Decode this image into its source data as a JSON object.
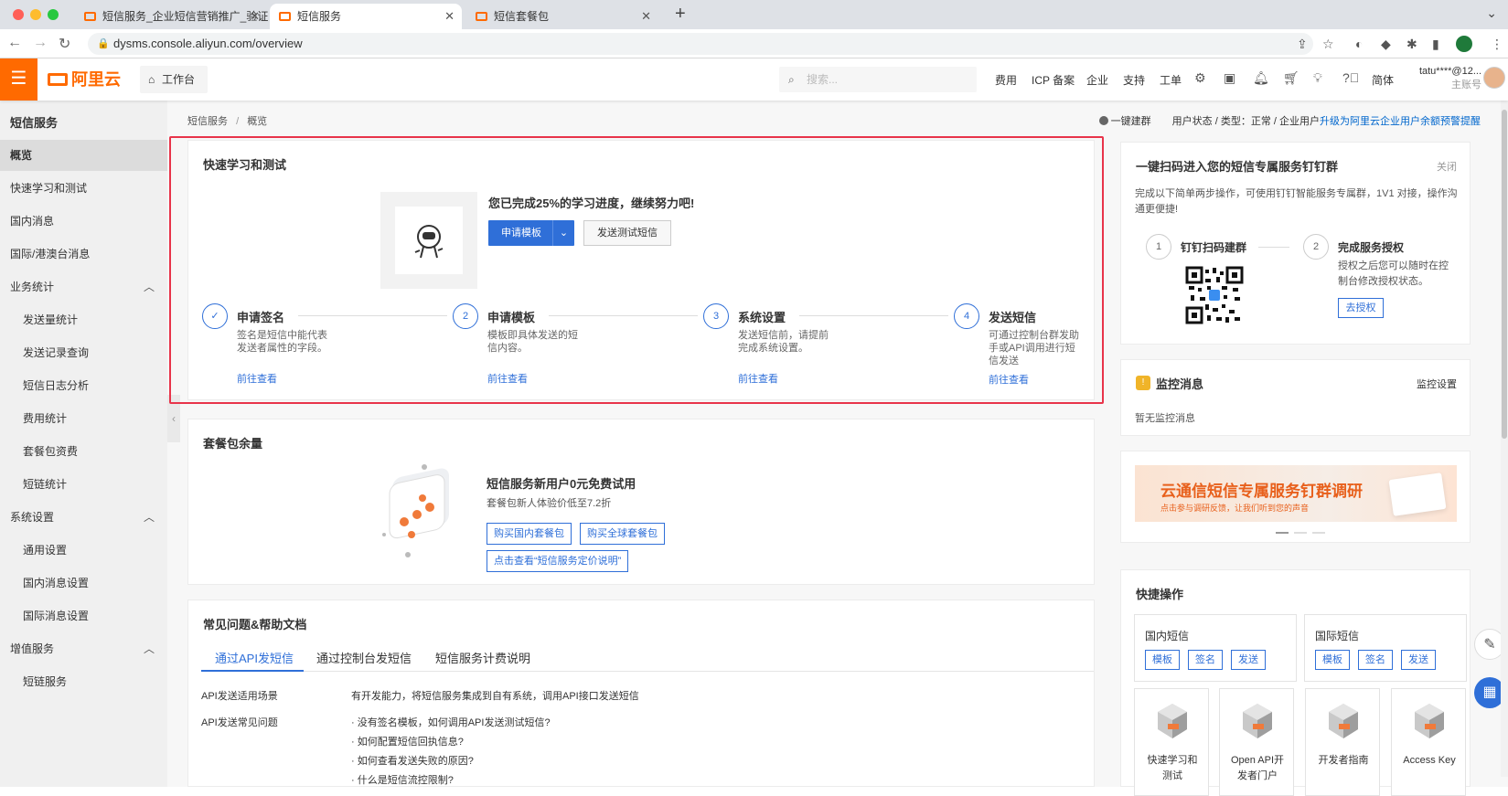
{
  "browser": {
    "tabs": [
      {
        "title": "短信服务_企业短信营销推广_验证"
      },
      {
        "title": "短信服务"
      },
      {
        "title": "短信套餐包"
      }
    ],
    "new_tab": "+",
    "url": "dysms.console.aliyun.com/overview"
  },
  "header": {
    "logo": "阿里云",
    "workbench": "工作台",
    "search_placeholder": "搜索...",
    "nav": [
      "费用",
      "ICP 备案",
      "企业",
      "支持",
      "工单"
    ],
    "lang": "简体",
    "user_name": "tatu****@12...",
    "user_role": "主账号"
  },
  "sidebar": {
    "title": "短信服务",
    "items": [
      {
        "label": "概览"
      },
      {
        "label": "快速学习和测试"
      },
      {
        "label": "国内消息"
      },
      {
        "label": "国际/港澳台消息"
      },
      {
        "label": "业务统计"
      },
      {
        "label": "发送量统计"
      },
      {
        "label": "发送记录查询"
      },
      {
        "label": "短信日志分析"
      },
      {
        "label": "费用统计"
      },
      {
        "label": "套餐包资费"
      },
      {
        "label": "短链统计"
      },
      {
        "label": "系统设置"
      },
      {
        "label": "通用设置"
      },
      {
        "label": "国内消息设置"
      },
      {
        "label": "国际消息设置"
      },
      {
        "label": "增值服务"
      },
      {
        "label": "短链服务"
      }
    ]
  },
  "breadcrumb": {
    "root": "短信服务",
    "sep": "/",
    "current": "概览"
  },
  "status_bar": {
    "group": "一键建群",
    "status_text": "用户状态 / 类型：正常 / 企业用户",
    "upgrade_link": "升级为阿里云企业用户余额预警提醒"
  },
  "quick_learn": {
    "title": "快速学习和测试",
    "progress_msg": "您已完成25%的学习进度，继续努力吧!",
    "apply_template": "申请模板",
    "send_test": "发送测试短信",
    "steps": [
      {
        "num": "✓",
        "title": "申请签名",
        "desc": "签名是短信中能代表发送者属性的字段。",
        "link": "前往查看"
      },
      {
        "num": "2",
        "title": "申请模板",
        "desc": "模板即具体发送的短信内容。",
        "link": "前往查看"
      },
      {
        "num": "3",
        "title": "系统设置",
        "desc": "发送短信前，请提前完成系统设置。",
        "link": "前往查看"
      },
      {
        "num": "4",
        "title": "发送短信",
        "desc": "可通过控制台群发助手或API调用进行短信发送",
        "link": "前往查看"
      }
    ]
  },
  "package": {
    "title": "套餐包余量",
    "promo_title": "短信服务新用户0元免费试用",
    "promo_sub": "套餐包新人体验价低至7.2折",
    "btn_domestic": "购买国内套餐包",
    "btn_global": "购买全球套餐包",
    "btn_pricing": "点击查看“短信服务定价说明”"
  },
  "faq": {
    "title": "常见问题&帮助文档",
    "tabs": [
      "通过API发短信",
      "通过控制台发短信",
      "短信服务计费说明"
    ],
    "rows": [
      {
        "label": "API发送适用场景",
        "values": [
          "有开发能力，将短信服务集成到自有系统，调用API接口发送短信"
        ]
      },
      {
        "label": "API发送常见问题",
        "values": [
          "· 没有签名模板，如何调用API发送测试短信?",
          "· 如何配置短信回执信息?",
          "· 如何查看发送失败的原因?",
          "· 什么是短信流控限制?"
        ]
      }
    ]
  },
  "dingtalk": {
    "title": "一键扫码进入您的短信专属服务钉钉群",
    "close": "关闭",
    "desc": "完成以下简单两步操作，可使用钉钉智能服务专属群，1V1 对接，操作沟通更便捷!",
    "step1_num": "1",
    "step1": "钉钉扫码建群",
    "step2_num": "2",
    "step2": "完成服务授权",
    "step2_desc": "授权之后您可以随时在控制台修改授权状态。",
    "authorize": "去授权"
  },
  "monitor": {
    "title": "监控消息",
    "settings": "监控设置",
    "empty": "暂无监控消息"
  },
  "banner": {
    "title": "云通信短信专属服务钉群调研",
    "sub": "点击参与调研反馈，让我们听到您的声音"
  },
  "quick_ops": {
    "title": "快捷操作",
    "domestic": {
      "title": "国内短信",
      "buttons": [
        "模板",
        "签名",
        "发送"
      ]
    },
    "intl": {
      "title": "国际短信",
      "buttons": [
        "模板",
        "签名",
        "发送"
      ]
    },
    "cards": [
      {
        "line1": "快速学习和",
        "line2": "测试"
      },
      {
        "line1": "Open API开",
        "line2": "发者门户"
      },
      {
        "line1": "开发者指南",
        "line2": ""
      },
      {
        "line1": "Access Key",
        "line2": ""
      }
    ]
  },
  "colors": {
    "brand": "#ff6a00",
    "primary": "#2f6fd8",
    "highlight": "#e8344a"
  }
}
